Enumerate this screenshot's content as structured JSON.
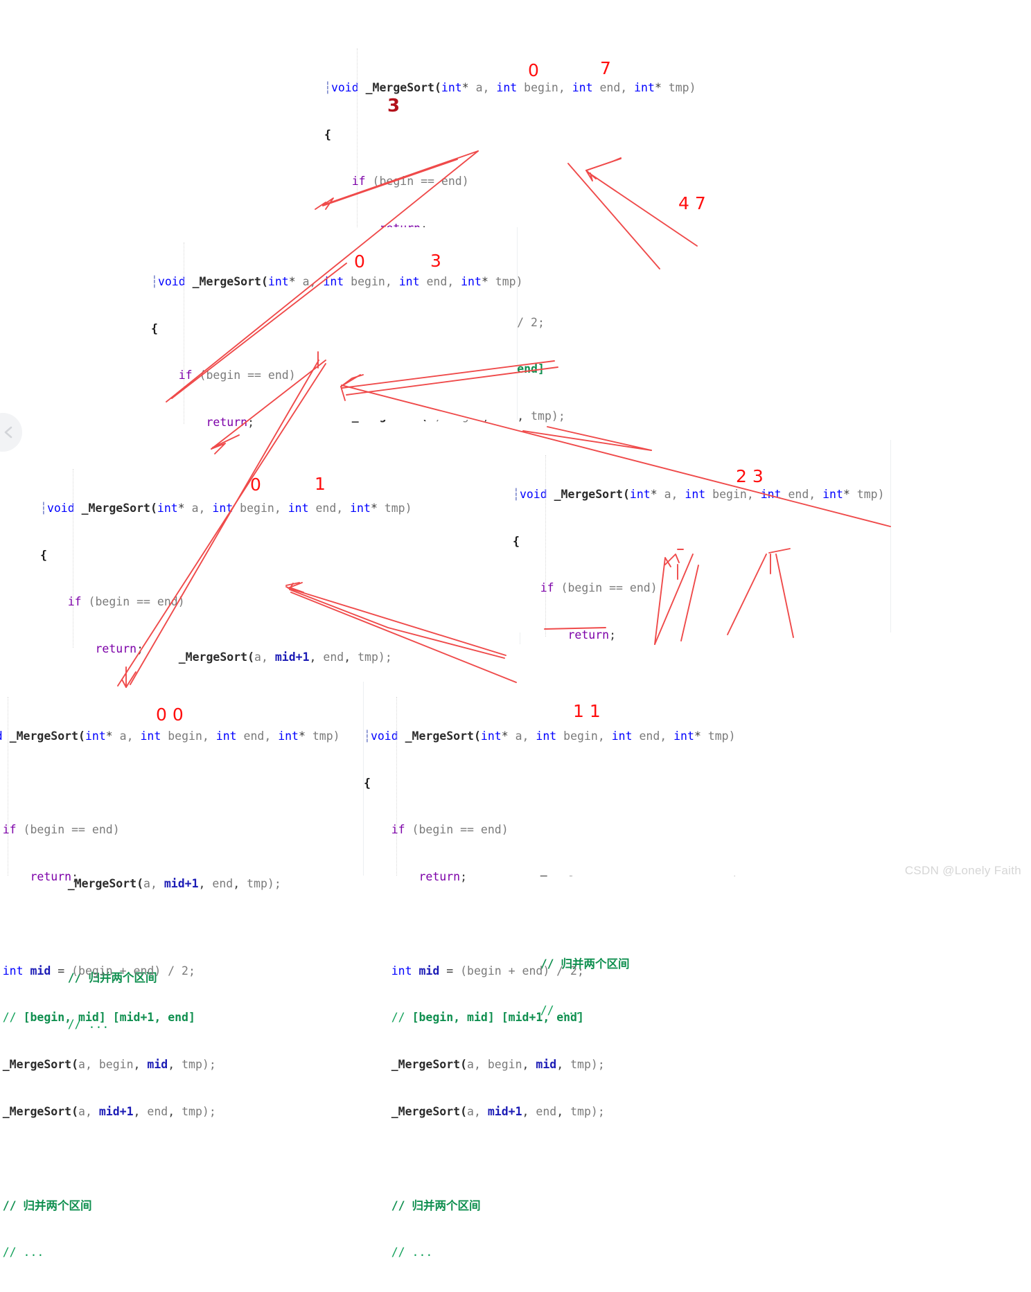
{
  "code": {
    "signature_full": "void _MergeSort(int* a, int begin, int end, int* tmp)",
    "signature_clipped": "oid _MergeSort(int* a, int begin, int end, int* tmp)",
    "tokens": {
      "void": "void",
      "fname": "_MergeSort(",
      "int": "int",
      "star": "*",
      "a": " a, ",
      "begin": " begin, ",
      "end": " end, ",
      "tmp": " tmp)",
      "open_brace": "{",
      "if_kw": "if",
      "if_cond": " (begin == end)",
      "return_kw": "return",
      "semi": ";",
      "int_kw": "int",
      "mid_decl": " mid ",
      "eq": "= ",
      "mid_expr": "(begin + end) / 2;",
      "comment_range": "// [begin, mid] [mid+1, end]",
      "call_left": "_MergeSort(a, begin, mid, tmp);",
      "call_right": "_MergeSort(a, mid+1, end, tmp);",
      "comment_merge": "// 归并两个区间",
      "comment_dots": "// ..."
    },
    "call_parts": {
      "name": "_MergeSort(",
      "arg_a": "a, ",
      "arg_begin": "begin",
      "arg_midplus": "mid+1",
      "arg_mid": "mid",
      "arg_end": "end",
      "comma": ", ",
      "arg_tmp": "tmp);"
    },
    "comment_parts": {
      "slashes": "// ",
      "bracket1": "[begin, mid]",
      "space": " ",
      "bracket2": "[mid+1, end]"
    }
  },
  "panels": [
    {
      "id": "panel-root-0-7",
      "name": "mergesort-frame-0-7",
      "range_label": "0        7",
      "range_begin": "0",
      "range_end": "7",
      "mid_label": "3",
      "clipped_left": false
    },
    {
      "id": "panel-0-3",
      "name": "mergesort-frame-0-3",
      "range_begin": "0",
      "range_end": "3",
      "clipped_left": false
    },
    {
      "id": "panel-0-1",
      "name": "mergesort-frame-0-1",
      "range_begin": "0",
      "range_end": "1",
      "clipped_left": false
    },
    {
      "id": "panel-2-3",
      "name": "mergesort-frame-2-3",
      "range_label": "2 3",
      "clipped_left": false
    },
    {
      "id": "panel-0-0",
      "name": "mergesort-frame-0-0",
      "range_label": "0 0",
      "clipped_left": true
    },
    {
      "id": "panel-1-1",
      "name": "mergesort-frame-1-1",
      "range_label": "1 1",
      "clipped_left": false
    }
  ],
  "annotations": {
    "root_begin": "0",
    "root_end": "7",
    "root_mid": "3",
    "right_subrange": "4 7",
    "left_child_begin": "0",
    "left_child_end": "3",
    "grandchild_begin": "0",
    "grandchild_end": "1",
    "right_grandchild": "2 3",
    "leaf_00": "0 0",
    "leaf_11": "1 1"
  },
  "colors": {
    "annotation_red": "#ff0d0d",
    "annotation_dark_red": "#b3111b",
    "ink_red": "#ef4a4a",
    "keyword_blue": "#0000ff",
    "keyword_purple": "#7c00a8",
    "comment_green": "#12a15a",
    "identifier_gray": "#7a7a7a",
    "variable_blue": "#1b1bb5",
    "background": "#ffffff",
    "panel_border": "#eceff1"
  },
  "nav": {
    "prev_icon": "chevron-left-icon"
  },
  "watermark": {
    "text": "CSDN @Lonely Faith"
  }
}
